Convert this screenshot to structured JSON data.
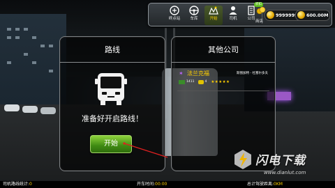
{
  "nav": {
    "items": [
      {
        "label": "终点站",
        "icon": "bus-stop-icon"
      },
      {
        "label": "车库",
        "icon": "steering-wheel-icon"
      },
      {
        "label": "开始",
        "icon": "route-map-icon",
        "active": true
      },
      {
        "label": "司机",
        "icon": "driver-icon"
      },
      {
        "label": "公司",
        "icon": "building-icon"
      },
      {
        "label": "商店",
        "icon": "coins-icon"
      }
    ]
  },
  "currency": {
    "coins": "9999999",
    "money": "600.00M",
    "badge": "折扣"
  },
  "route_panel": {
    "title": "路线",
    "ready_text": "准备好开启路线！",
    "start_label": "开始"
  },
  "company_panel": {
    "title": "其他公司",
    "company": {
      "name": "法兰克福",
      "region": "斯图加特 - 杜塞尔多夫",
      "count_a": "1411",
      "count_b": "4",
      "stars": "★★★★★"
    }
  },
  "status": {
    "route_stats_label": "司机路线统计:",
    "route_stats_value": "0",
    "drive_time_label": "开车时间:",
    "drive_time_value": "00:00",
    "distance_label": "总计驾驶距离:",
    "distance_value": "0KM"
  },
  "watermark": {
    "text": "闪电下载",
    "url": "www.dianlut.com"
  },
  "colors": {
    "accent_yellow": "#ffd000",
    "start_green": "#5cb321",
    "panel_border": "#7e8285"
  }
}
